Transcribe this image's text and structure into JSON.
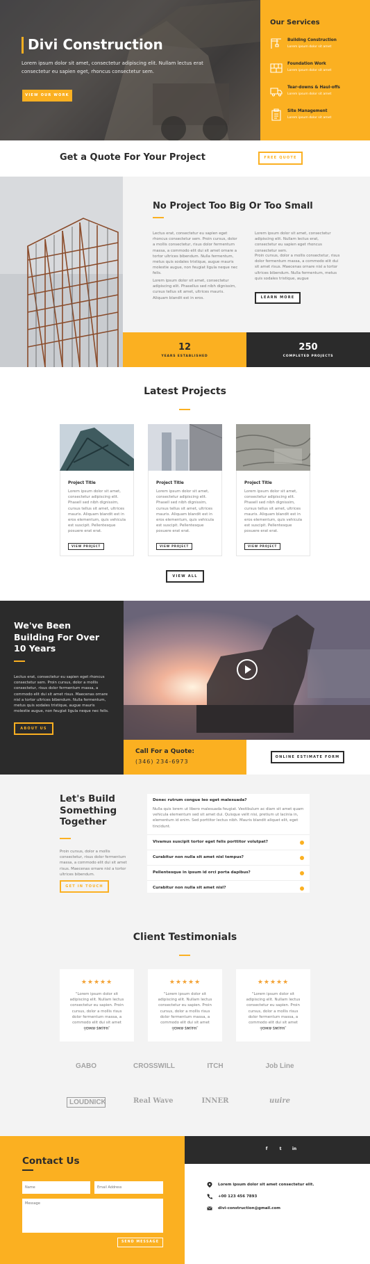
{
  "hero": {
    "title": "Divi Construction",
    "subtitle": "Lorem ipsum dolor sit amet, consectetur adipiscing elit. Nullam lectus erat consectetur eu sapien eget, rhoncus consectetur sem.",
    "button": "VIEW OUR WORK"
  },
  "services": {
    "heading": "Our Services",
    "items": [
      {
        "title": "Building Construction",
        "text": "Lorem ipsum dolor sit amet",
        "icon": "crane-icon"
      },
      {
        "title": "Foundation Work",
        "text": "Lorem ipsum dolor sit amet",
        "icon": "bricks-icon"
      },
      {
        "title": "Tear-downs & Haul-offs",
        "text": "Lorem ipsum dolor sit amet",
        "icon": "truck-icon"
      },
      {
        "title": "Site Management",
        "text": "Lorem ipsum dolor sit amet",
        "icon": "clipboard-icon"
      }
    ]
  },
  "quote_bar": {
    "title": "Get a Quote For Your Project",
    "button": "FREE QUOTE"
  },
  "about": {
    "title": "No Project Too Big Or Too Small",
    "col1_p1": "Lectus erat, consectetur eu sapien eget rhoncus consectetur sem. Proin cursus, dolor a mollis consectetur, risus dolor fermentum massa, a commodo elit dui sit amet ornare a tortor ultrices bibendum. Nulla fermentum, metus quis sodales tristique, augue mauris molestie augue, non feugiat ligula neque nec felis.",
    "col1_p2": "Lorem ipsum dolor sit amet, consectetur adipiscing elit. Phasellus sed nibh dignissim, cursus tellus sit amet, ultrices mauris. Aliquam blandit est in eros.",
    "col2_p1": "Lorem ipsum dolor sit amet, consectetur adipiscing elit. Nullam lectus erat, consectetur eu sapien eget rhoncus consectetur sem.",
    "col2_p2": "Proin cursus, dolor a mollis consectetur, risus dolor fermentum massa, a commodo elit dui sit amet risus. Maecenas ornare nisl a tortor ultrices bibendum. Nulla fermentum, metus quis sodales tristique, augue",
    "button": "LEARN MORE"
  },
  "stats": [
    {
      "value": "12",
      "label": "YEARS ESTABLISHED"
    },
    {
      "value": "250",
      "label": "COMPLETED PROJECTS"
    }
  ],
  "projects": {
    "heading": "Latest Projects",
    "items": [
      {
        "title": "Project Title",
        "text": "Lorem ipsum dolor sit amet, consectetur adipiscing elit. Phasell sed nibh dignissim, cursus tellus sit amet, ultrices mauris. Aliquam blandit est in eros elementum, quis vehicula est suscipit. Pellentesque posuere erat erat.",
        "button": "VIEW PROJECT"
      },
      {
        "title": "Project Title",
        "text": "Lorem ipsum dolor sit amet, consectetur adipiscing elit. Phasell sed nibh dignissim, cursus tellus sit amet, ultrices mauris. Aliquam blandit est in eros elementum, quis vehicula est suscipit. Pellentesque posuere erat erat.",
        "button": "VIEW PROJECT"
      },
      {
        "title": "Project Title",
        "text": "Lorem ipsum dolor sit amet, consectetur adipiscing elit. Phasell sed nibh dignissim, cursus tellus sit amet, ultrices mauris. Aliquam blandit est in eros elementum, quis vehicula est suscipit. Pellentesque posuere erat erat.",
        "button": "VIEW PROJECT"
      }
    ],
    "view_all": "VIEW ALL"
  },
  "experience": {
    "title": "We've Been Building For Over 10 Years",
    "text": "Lectus erat, consectetur eu sapien eget rhoncus consectetur sem. Proin cursus, dolor a mollis consectetur, risus dolor fermentum massa, a commodo elit dui sit amet risus. Maecenas ornare nisl a tortor ultrices bibendum. Nulla fermentum, metus quis sodales tristique, augue mauris molestie augue, non feugiat ligula neque nec felis.",
    "button": "ABOUT US"
  },
  "call": {
    "label": "Call For a Quote:",
    "phone": "(346) 234-6973",
    "button": "ONLINE ESTIMATE FORM"
  },
  "faq": {
    "title": "Let's Build Something Together",
    "text": "Proin cursus, dolor a mollis consectetur, risus dolor fermentum massa, a commodo elit dui sit amet risus. Maecenas ornare nisl a tortor ultrices bibendum.",
    "button": "GET IN TOUCH",
    "open_question": "Donec rutrum congue leo eget malesuada?",
    "open_answer": "Nulla quis lorem ut libero malesuada feugiat. Vestibulum ac diam sit amet quam vehicula elementum sed sit amet dui. Quisque velit nisi, pretium ut lacinia in, elementum id enim. Sed porttitor lectus nibh. Mauris blandit aliquet elit, eget tincidunt.",
    "questions": [
      "Vivamus suscipit tortor eget felis porttitor volutpat?",
      "Curabitur non nulla sit amet nisl tempus?",
      "Pellentesque in ipsum id orci porta dapibus?",
      "Curabitur non nulla sit amet nisl?"
    ]
  },
  "testimonials": {
    "heading": "Client Testimonials",
    "items": [
      {
        "text": "\"Lorem ipsum dolor sit adipiscing elit. Nullam lectus consectetur eu sapien. Proin cursus, dolor a mollis risus dolor fermentum massa, a commodo elit dui sit amet ornare tortor.\"",
        "name": "JOHN SMITH"
      },
      {
        "text": "\"Lorem ipsum dolor sit adipiscing elit. Nullam lectus consectetur eu sapien. Proin cursus, dolor a mollis risus dolor fermentum massa, a commodo elit dui sit amet ornare tortor.\"",
        "name": "JOHN SMITH"
      },
      {
        "text": "\"Lorem ipsum dolor sit adipiscing elit. Nullam lectus consectetur eu sapien. Proin cursus, dolor a mollis risus dolor fermentum massa, a commodo elit dui sit amet ornare tortor.\"",
        "name": "JOHN SMITH"
      }
    ],
    "stars": "★★★★★"
  },
  "logos": [
    "GABO",
    "CROSSWILL",
    "ITCH",
    "Job Line",
    "LOUDNICK",
    "Real Wave",
    "INNER",
    "uuire"
  ],
  "contact": {
    "heading": "Contact Us",
    "name_placeholder": "Name",
    "email_placeholder": "Email Address",
    "message_placeholder": "Message",
    "button": "SEND MESSAGE",
    "address": "Lorem ipsum dolor sit amet consectetur elit.",
    "phone": "+00 123 456 7893",
    "email": "divi-construction@gmail.com",
    "social": [
      "f",
      "t",
      "in"
    ]
  },
  "colors": {
    "accent": "#fbb021",
    "dark": "#2b2b2b"
  }
}
